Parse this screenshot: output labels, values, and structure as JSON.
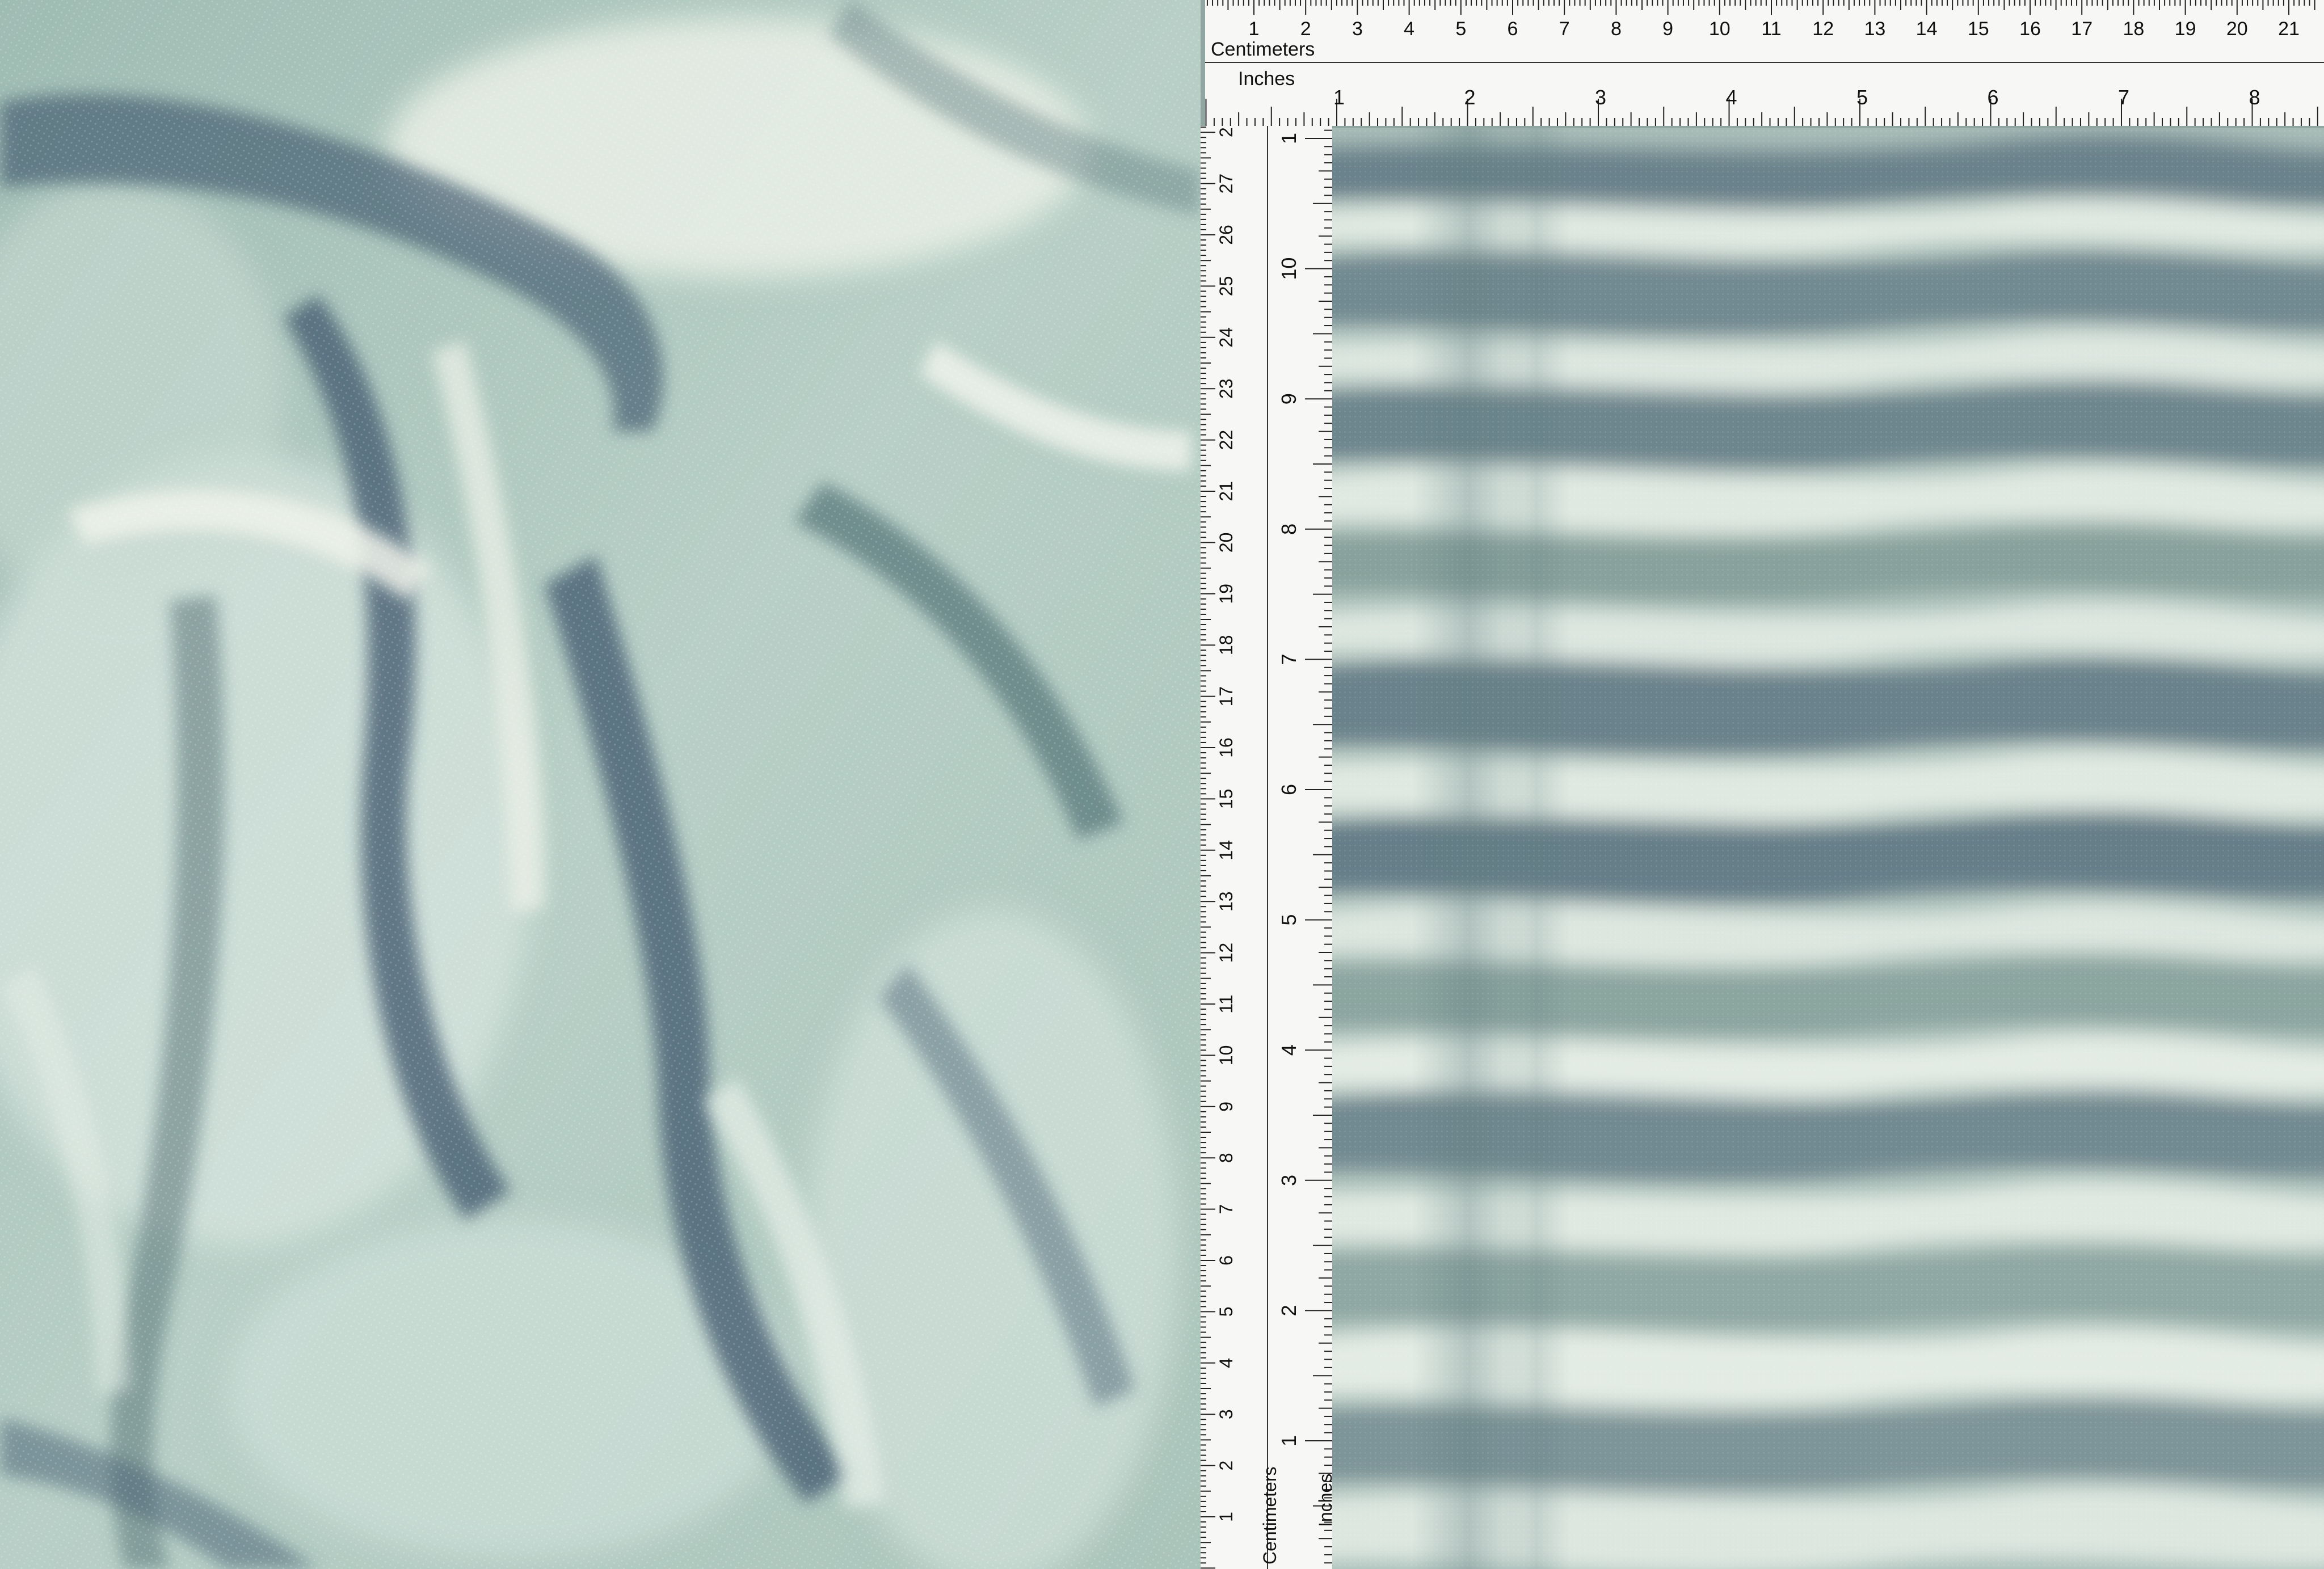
{
  "image": {
    "subject": "mesh-fabric-swatch",
    "palette": {
      "deep_slate_blue": "#4c6577",
      "sea_green": "#8fb2a8",
      "pale_mint": "#d9e6df",
      "cream_white": "#eef2ea",
      "shadow_teal": "#5f7d7f"
    }
  },
  "top_ruler": {
    "primary_unit": "Centimeters",
    "secondary_unit": "Inches",
    "cm_labels": [
      "1",
      "2",
      "3",
      "4",
      "5",
      "6",
      "7",
      "8",
      "9",
      "10",
      "11",
      "12",
      "13",
      "14",
      "15",
      "16",
      "17",
      "18",
      "19",
      "20",
      "21"
    ],
    "inch_labels": [
      "1",
      "2",
      "3",
      "4",
      "5",
      "6",
      "7",
      "8"
    ]
  },
  "left_ruler": {
    "primary_unit": "Centimeters",
    "secondary_unit": "Inches",
    "cm_labels": [
      "1",
      "2",
      "3",
      "4",
      "5",
      "6",
      "7",
      "8",
      "9",
      "10",
      "11",
      "12",
      "13",
      "14",
      "15",
      "16",
      "17",
      "18",
      "19",
      "20",
      "21",
      "22",
      "23",
      "24",
      "25",
      "26",
      "27",
      "2"
    ],
    "inch_labels": [
      "1",
      "2",
      "3",
      "4",
      "5",
      "6",
      "7",
      "8",
      "9",
      "10",
      "1"
    ]
  }
}
